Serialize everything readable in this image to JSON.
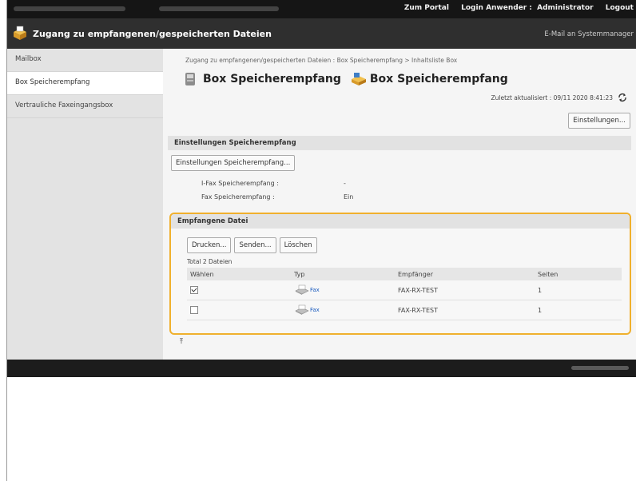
{
  "topbar": {
    "portal_link": "Zum Portal",
    "login_user_label": "Login Anwender :",
    "login_user_value": "Administrator",
    "logout_link": "Logout"
  },
  "app": {
    "title": "Zugang zu empfangenen/gespeicherten Dateien",
    "mail_admin_link": "E-Mail an Systemmanager"
  },
  "sidebar": {
    "items": [
      {
        "label": "Mailbox"
      },
      {
        "label": "Box Speicherempfang"
      },
      {
        "label": "Vertrauliche Faxeingangsbox"
      }
    ]
  },
  "main": {
    "breadcrumb": "Zugang zu empfangenen/gespeicherten Dateien : Box Speicherempfang > Inhaltsliste Box",
    "title_primary": "Box Speicherempfang",
    "title_secondary": "Box Speicherempfang",
    "last_updated": "Zuletzt aktualisiert : 09/11 2020 8:41:23",
    "settings_button": "Einstellungen..."
  },
  "settings_section": {
    "heading": "Einstellungen Speicherempfang",
    "button": "Einstellungen Speicherempfang...",
    "ifax_label": "I-Fax Speicherempfang :",
    "ifax_value": "-",
    "fax_label": "Fax Speicherempfang :",
    "fax_value": "Ein"
  },
  "received_section": {
    "heading": "Empfangene Datei",
    "buttons": {
      "print": "Drucken...",
      "send": "Senden...",
      "delete": "Löschen"
    },
    "total": "Total 2 Dateien",
    "columns": [
      "Wählen",
      "Typ",
      "Empfänger",
      "Seiten"
    ],
    "rows": [
      {
        "checked": true,
        "type": "Fax",
        "recipient": "FAX-RX-TEST",
        "pages": "1"
      },
      {
        "checked": false,
        "type": "Fax",
        "recipient": "FAX-RX-TEST",
        "pages": "1"
      }
    ]
  },
  "icons": [
    "app-box-icon",
    "box-icon",
    "memory-box-icon",
    "refresh-icon",
    "fax-icon",
    "scroll-top-icon"
  ],
  "colors": {
    "highlight": "#f0b02d",
    "link": "#1a5bbf",
    "topbar": "#151515",
    "titlebar": "#2f2f2f"
  }
}
